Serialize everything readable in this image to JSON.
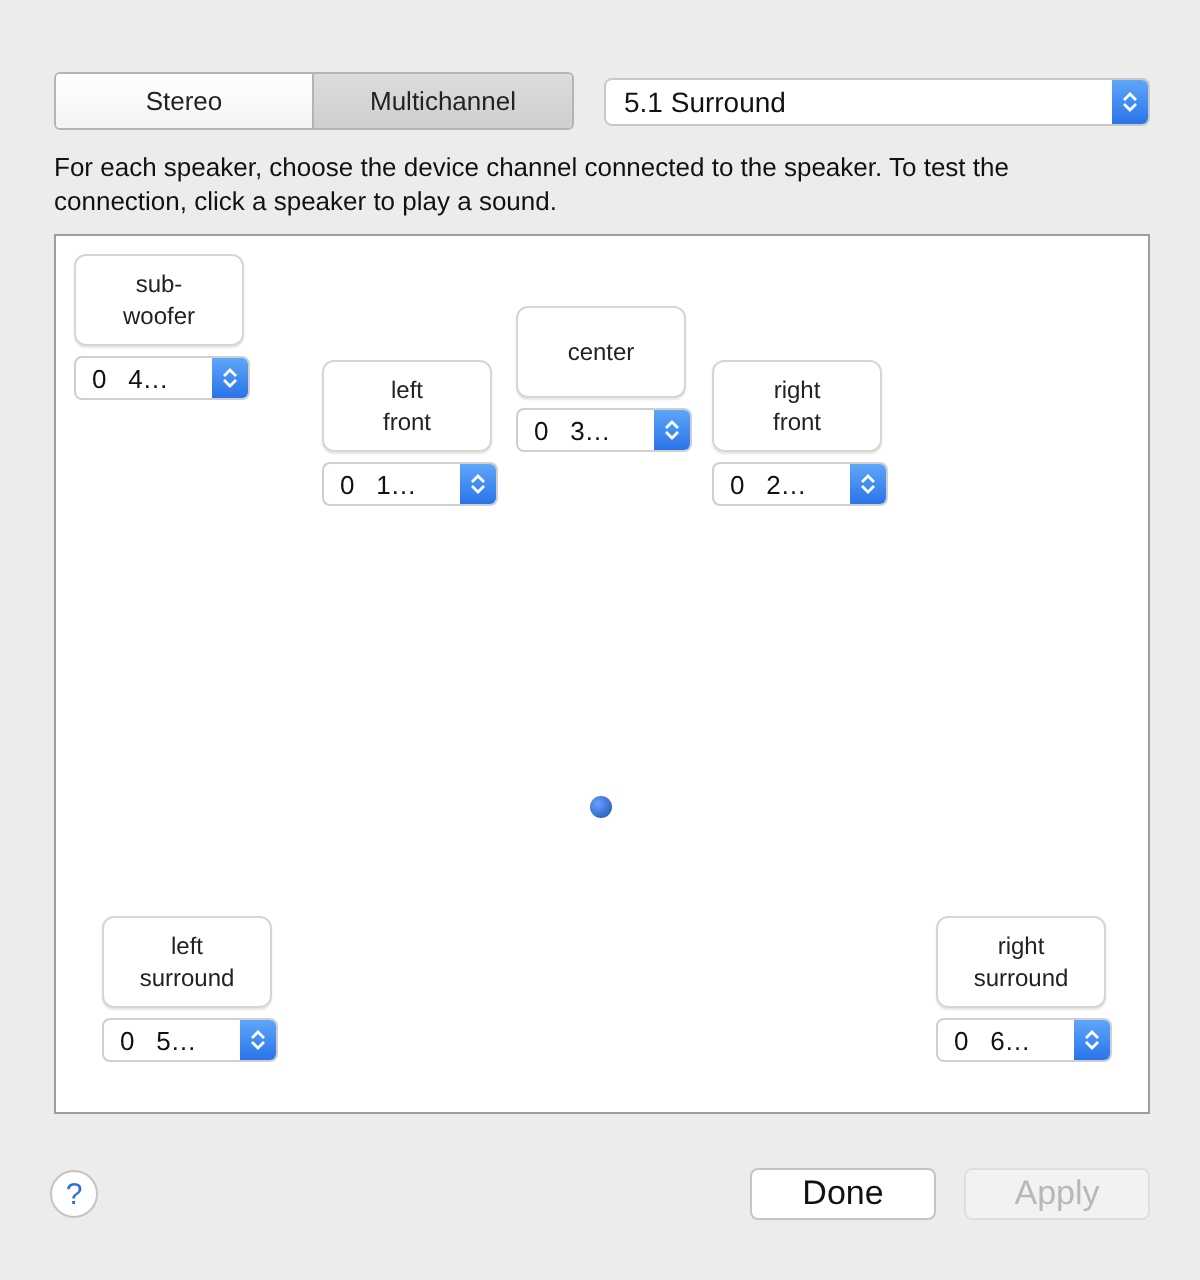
{
  "modes": [
    {
      "label": "Stereo",
      "selected": false
    },
    {
      "label": "Multichannel",
      "selected": true
    }
  ],
  "configuration": {
    "value": "5.1 Surround"
  },
  "instructions": "For each speaker, choose the device channel connected to the speaker. To test the connection, click a speaker to play a sound.",
  "speakers": [
    {
      "label": "sub-\nwoofer",
      "channel": "0   4…",
      "kind": "sub"
    },
    {
      "label": "left\nfront",
      "channel": "0   1…",
      "kind": "lf"
    },
    {
      "label": "center",
      "channel": "0   3…",
      "kind": "c"
    },
    {
      "label": "right\nfront",
      "channel": "0   2…",
      "kind": "rf"
    },
    {
      "label": "left\nsurround",
      "channel": "0   5…",
      "kind": "ls"
    },
    {
      "label": "right\nsurround",
      "channel": "0   6…",
      "kind": "rs"
    }
  ],
  "help": "?",
  "buttons": [
    {
      "label": "Done",
      "disabled": false
    },
    {
      "label": "Apply",
      "disabled": true
    }
  ]
}
